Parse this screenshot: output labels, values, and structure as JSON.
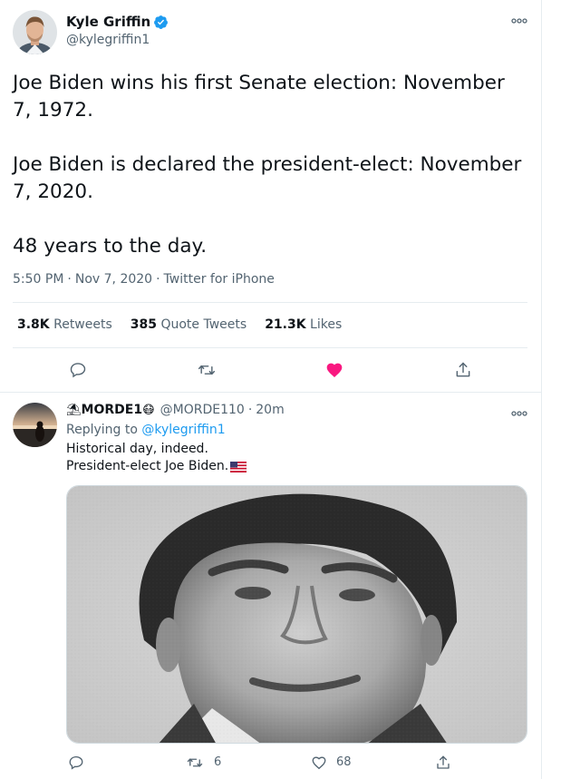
{
  "main_tweet": {
    "author_name": "Kyle Griffin",
    "author_handle": "@kylegriffin1",
    "text_lines": [
      "Joe Biden wins his first Senate election: November 7, 1972.",
      "Joe Biden is declared the president-elect: November 7, 2020.",
      "48 years to the day."
    ],
    "time": "5:50 PM",
    "date": "Nov 7, 2020",
    "source": "Twitter for iPhone",
    "stats": {
      "retweets_count": "3.8K",
      "retweets_label": "Retweets",
      "quotes_count": "385",
      "quotes_label": "Quote Tweets",
      "likes_count": "21.3K",
      "likes_label": "Likes"
    },
    "liked": true,
    "colors": {
      "like_active": "#f91880",
      "verified": "#1d9bf0",
      "icon": "#536471"
    }
  },
  "reply": {
    "display_name": "MORDE1",
    "name_emoji_prefix": "⛱",
    "name_emoji_suffix": "😷",
    "handle": "@MORDE110",
    "separator": "·",
    "time_ago": "20m",
    "replying_to_label": "Replying to",
    "replying_to_handle": "@kylegriffin1",
    "text_line1": "Historical day, indeed.",
    "text_line2": "President-elect Joe Biden.",
    "flag": "us-flag",
    "reply_count": "",
    "retweet_count": "6",
    "like_count": "68"
  },
  "icons": {
    "more": "more-horizontal-icon",
    "reply": "reply-icon",
    "retweet": "retweet-icon",
    "like": "heart-icon",
    "share": "share-icon"
  }
}
